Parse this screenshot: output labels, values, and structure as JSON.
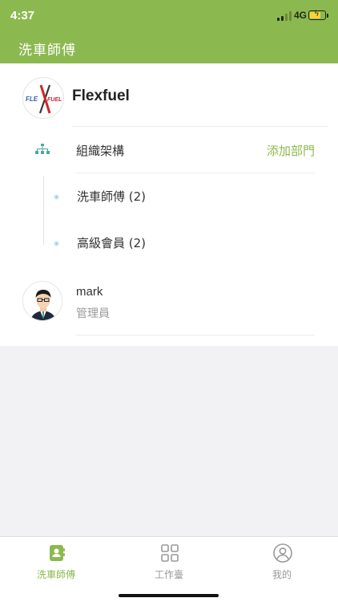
{
  "status_bar": {
    "time": "4:37",
    "network": "4G"
  },
  "header": {
    "title": "洗車師傅"
  },
  "company": {
    "name": "Flexfuel",
    "logo_text_left": "FLE",
    "logo_text_right": "FUEL",
    "logo_x": "X"
  },
  "org": {
    "label": "組織架構",
    "add_label": "添加部門"
  },
  "departments": [
    {
      "label": "洗車師傅 (2)"
    },
    {
      "label": "高級會員 (2)"
    }
  ],
  "user": {
    "name": "mark",
    "role": "管理員"
  },
  "tabs": [
    {
      "label": "洗車師傅",
      "icon": "contacts-icon",
      "active": true
    },
    {
      "label": "工作臺",
      "icon": "grid-icon",
      "active": false
    },
    {
      "label": "我的",
      "icon": "profile-icon",
      "active": false
    }
  ],
  "colors": {
    "accent": "#8cb94f",
    "tree_dot": "#8dd2d6",
    "org_icon": "#4aa7a5"
  }
}
